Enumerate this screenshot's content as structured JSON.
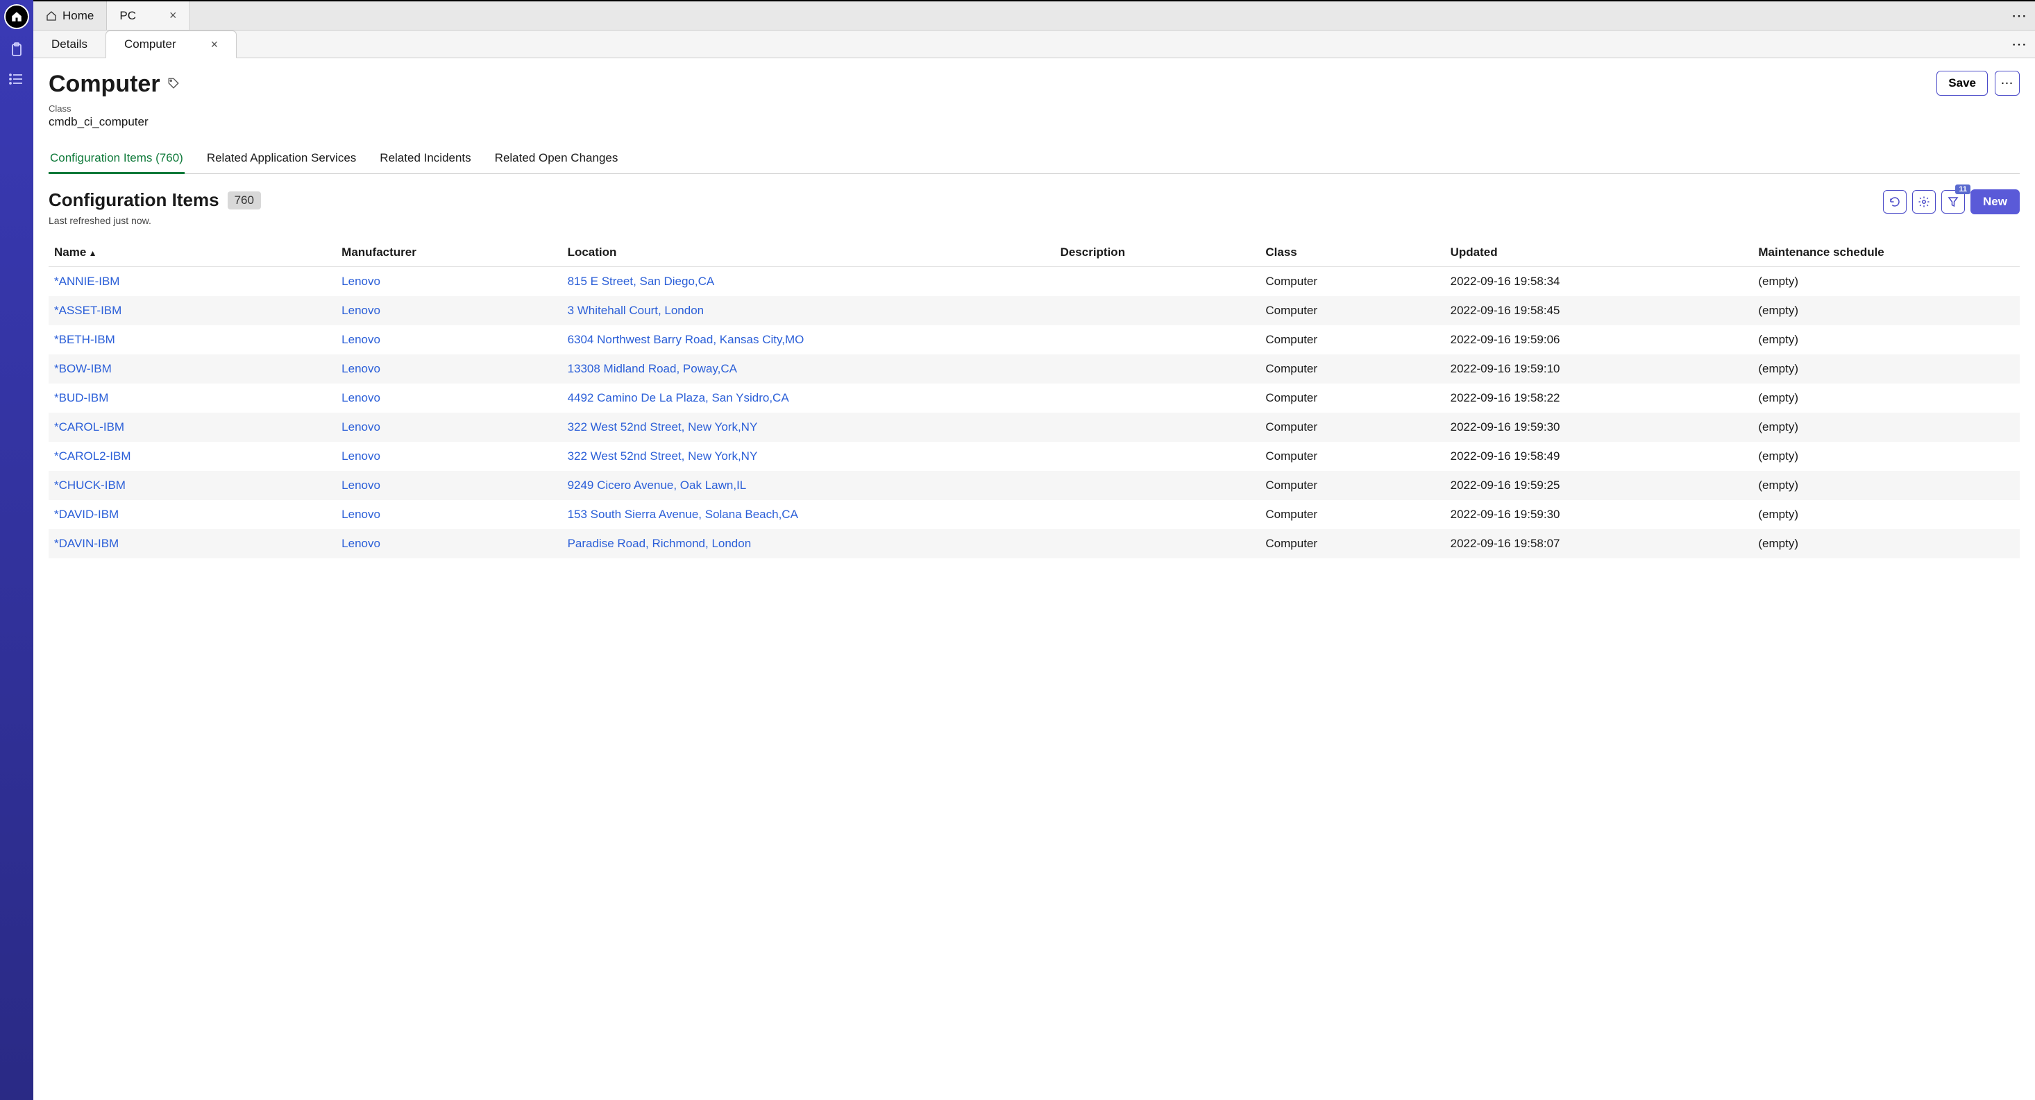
{
  "nav": {
    "rail_items": [
      "home",
      "clipboard",
      "list"
    ]
  },
  "top_tabs": [
    {
      "label": "Home",
      "closable": false,
      "icon": "home"
    },
    {
      "label": "PC",
      "closable": true,
      "active": true
    }
  ],
  "sub_tabs": [
    {
      "label": "Details",
      "closable": false
    },
    {
      "label": "Computer",
      "closable": true,
      "active": true
    }
  ],
  "header": {
    "title": "Computer",
    "save_label": "Save",
    "more_label": "⋯",
    "class_label": "Class",
    "class_value": "cmdb_ci_computer"
  },
  "record_tabs": [
    {
      "label": "Configuration Items (760)",
      "active": true
    },
    {
      "label": "Related Application Services"
    },
    {
      "label": "Related Incidents"
    },
    {
      "label": "Related Open Changes"
    }
  ],
  "list": {
    "title": "Configuration Items",
    "count": "760",
    "last_refreshed": "Last refreshed just now.",
    "filter_count": "11",
    "new_label": "New",
    "columns": [
      "Name",
      "Manufacturer",
      "Location",
      "Description",
      "Class",
      "Updated",
      "Maintenance schedule"
    ],
    "sort_column": "Name",
    "rows": [
      {
        "name": "*ANNIE-IBM",
        "manufacturer": "Lenovo",
        "location": "815 E Street, San Diego,CA",
        "description": "",
        "class": "Computer",
        "updated": "2022-09-16 19:58:34",
        "maintenance": "(empty)"
      },
      {
        "name": "*ASSET-IBM",
        "manufacturer": "Lenovo",
        "location": "3 Whitehall Court, London",
        "description": "",
        "class": "Computer",
        "updated": "2022-09-16 19:58:45",
        "maintenance": "(empty)"
      },
      {
        "name": "*BETH-IBM",
        "manufacturer": "Lenovo",
        "location": "6304 Northwest Barry Road, Kansas City,MO",
        "description": "",
        "class": "Computer",
        "updated": "2022-09-16 19:59:06",
        "maintenance": "(empty)"
      },
      {
        "name": "*BOW-IBM",
        "manufacturer": "Lenovo",
        "location": "13308 Midland Road, Poway,CA",
        "description": "",
        "class": "Computer",
        "updated": "2022-09-16 19:59:10",
        "maintenance": "(empty)"
      },
      {
        "name": "*BUD-IBM",
        "manufacturer": "Lenovo",
        "location": "4492 Camino De La Plaza, San Ysidro,CA",
        "description": "",
        "class": "Computer",
        "updated": "2022-09-16 19:58:22",
        "maintenance": "(empty)"
      },
      {
        "name": "*CAROL-IBM",
        "manufacturer": "Lenovo",
        "location": "322 West 52nd Street, New York,NY",
        "description": "",
        "class": "Computer",
        "updated": "2022-09-16 19:59:30",
        "maintenance": "(empty)"
      },
      {
        "name": "*CAROL2-IBM",
        "manufacturer": "Lenovo",
        "location": "322 West 52nd Street, New York,NY",
        "description": "",
        "class": "Computer",
        "updated": "2022-09-16 19:58:49",
        "maintenance": "(empty)"
      },
      {
        "name": "*CHUCK-IBM",
        "manufacturer": "Lenovo",
        "location": "9249 Cicero Avenue, Oak Lawn,IL",
        "description": "",
        "class": "Computer",
        "updated": "2022-09-16 19:59:25",
        "maintenance": "(empty)"
      },
      {
        "name": "*DAVID-IBM",
        "manufacturer": "Lenovo",
        "location": "153 South Sierra Avenue, Solana Beach,CA",
        "description": "",
        "class": "Computer",
        "updated": "2022-09-16 19:59:30",
        "maintenance": "(empty)"
      },
      {
        "name": "*DAVIN-IBM",
        "manufacturer": "Lenovo",
        "location": "Paradise Road, Richmond, London",
        "description": "",
        "class": "Computer",
        "updated": "2022-09-16 19:58:07",
        "maintenance": "(empty)"
      }
    ]
  }
}
